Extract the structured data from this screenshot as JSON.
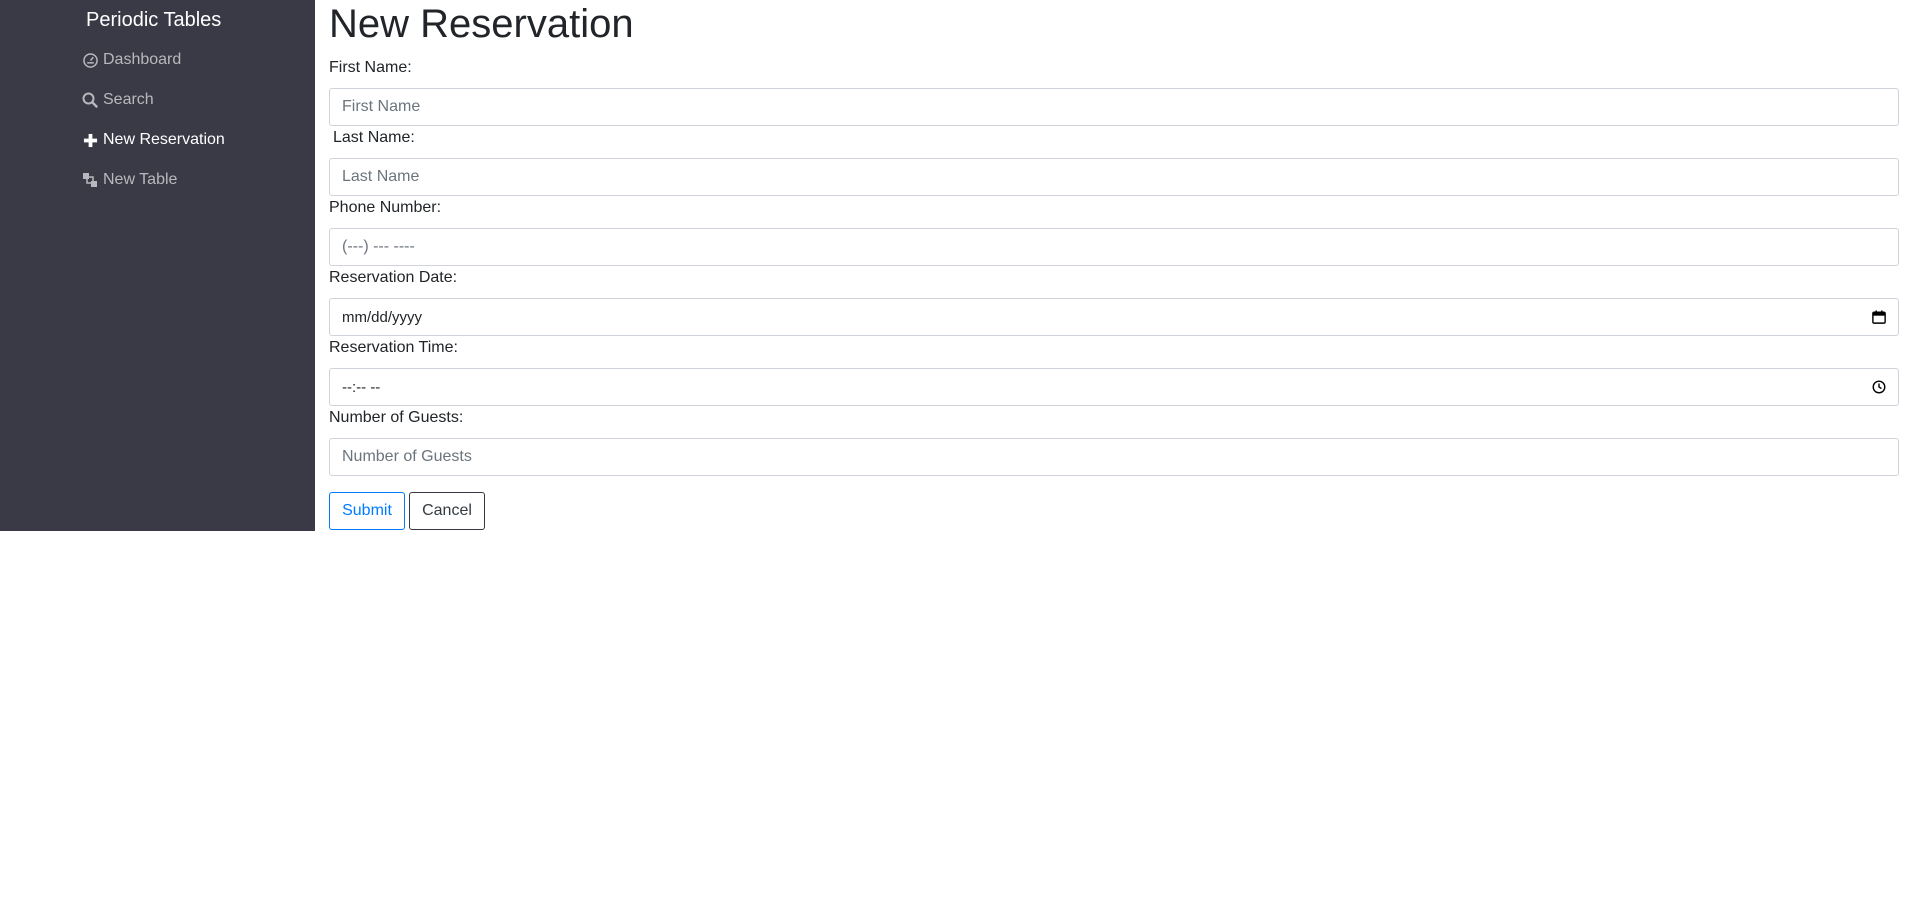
{
  "sidebar": {
    "brand": "Periodic Tables",
    "items": [
      {
        "label": "Dashboard",
        "icon": "dashboard-icon",
        "active": false
      },
      {
        "label": "Search",
        "icon": "search-icon",
        "active": false
      },
      {
        "label": "New Reservation",
        "icon": "plus-icon",
        "active": true
      },
      {
        "label": "New Table",
        "icon": "layers-icon",
        "active": false
      }
    ]
  },
  "main": {
    "title": "New Reservation",
    "fields": {
      "first_name": {
        "label": "First Name:",
        "placeholder": "First Name"
      },
      "last_name": {
        "label": "Last Name:",
        "placeholder": "Last Name"
      },
      "phone": {
        "label": "Phone Number:",
        "placeholder": "(---) --- ----"
      },
      "date": {
        "label": "Reservation Date:",
        "value": "mm/dd/yyyy",
        "icon": "calendar-icon"
      },
      "time": {
        "label": "Reservation Time:",
        "value": "--:-- --",
        "icon": "clock-icon"
      },
      "guests": {
        "label": "Number of Guests:",
        "placeholder": "Number of Guests"
      }
    },
    "buttons": {
      "submit": "Submit",
      "cancel": "Cancel"
    }
  },
  "colors": {
    "sidebar_bg": "#393a45",
    "primary": "#007bff",
    "dark": "#343a40"
  }
}
